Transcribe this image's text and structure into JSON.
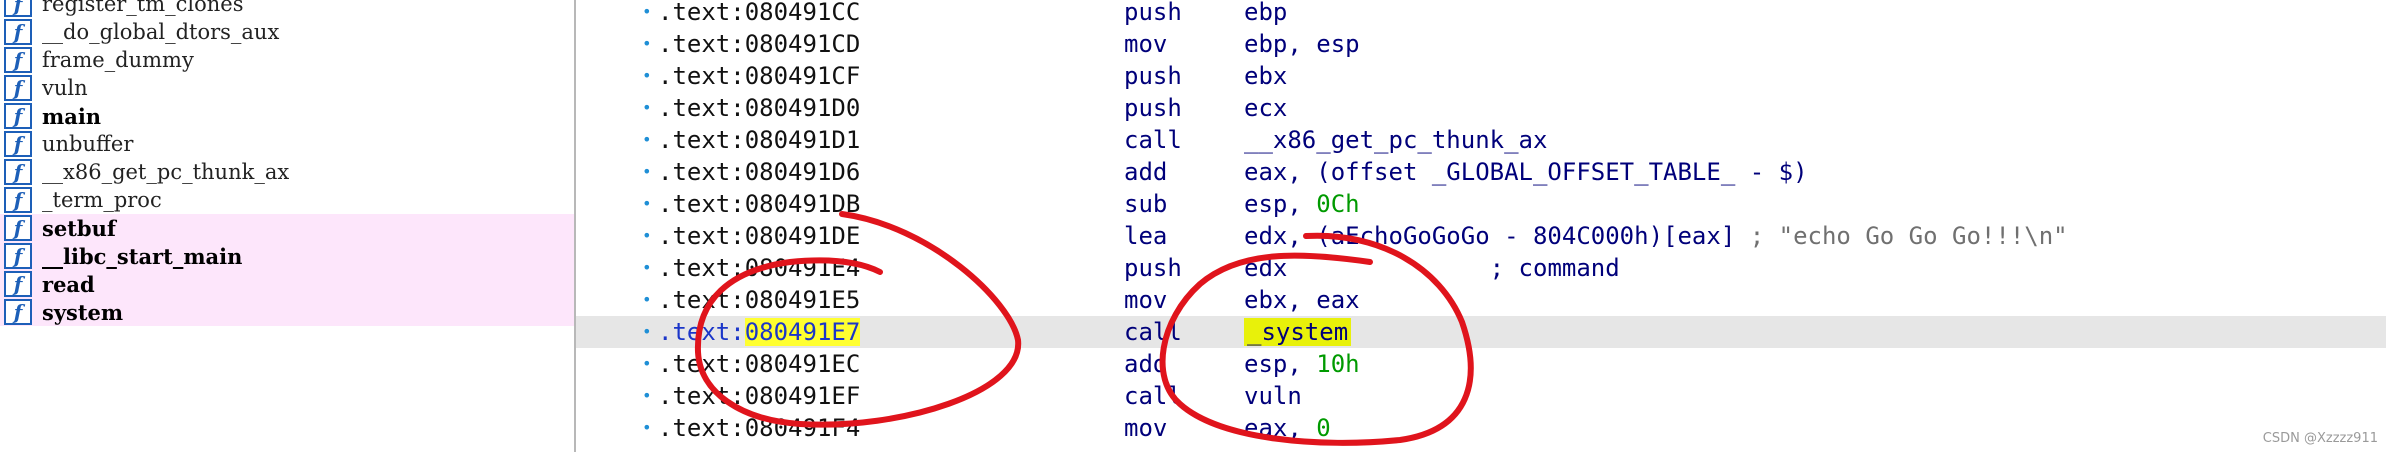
{
  "functions": [
    {
      "name": "register_tm_clones",
      "bold": false,
      "imported": false
    },
    {
      "name": "__do_global_dtors_aux",
      "bold": false,
      "imported": false
    },
    {
      "name": "frame_dummy",
      "bold": false,
      "imported": false
    },
    {
      "name": "vuln",
      "bold": false,
      "imported": false
    },
    {
      "name": "main",
      "bold": true,
      "imported": false
    },
    {
      "name": "unbuffer",
      "bold": false,
      "imported": false
    },
    {
      "name": "__x86_get_pc_thunk_ax",
      "bold": false,
      "imported": false
    },
    {
      "name": "_term_proc",
      "bold": false,
      "imported": false
    },
    {
      "name": "setbuf",
      "bold": true,
      "imported": true
    },
    {
      "name": "__libc_start_main",
      "bold": true,
      "imported": true
    },
    {
      "name": "read",
      "bold": true,
      "imported": true
    },
    {
      "name": "system",
      "bold": true,
      "imported": true
    }
  ],
  "function_icon": "function-icon",
  "disassembly": [
    {
      "seg": ".text:",
      "addr": "080491CC",
      "mnem": "push",
      "ops": [
        {
          "t": "ebp"
        }
      ]
    },
    {
      "seg": ".text:",
      "addr": "080491CD",
      "mnem": "mov",
      "ops": [
        {
          "t": "ebp, esp"
        }
      ]
    },
    {
      "seg": ".text:",
      "addr": "080491CF",
      "mnem": "push",
      "ops": [
        {
          "t": "ebx"
        }
      ]
    },
    {
      "seg": ".text:",
      "addr": "080491D0",
      "mnem": "push",
      "ops": [
        {
          "t": "ecx"
        }
      ]
    },
    {
      "seg": ".text:",
      "addr": "080491D1",
      "mnem": "call",
      "ops": [
        {
          "t": "__x86_get_pc_thunk_ax"
        }
      ]
    },
    {
      "seg": ".text:",
      "addr": "080491D6",
      "mnem": "add",
      "ops": [
        {
          "t": "eax, (offset _GLOBAL_OFFSET_TABLE_ - $)"
        }
      ]
    },
    {
      "seg": ".text:",
      "addr": "080491DB",
      "mnem": "sub",
      "ops": [
        {
          "t": "esp, "
        },
        {
          "t": "0Ch",
          "k": "num"
        }
      ]
    },
    {
      "seg": ".text:",
      "addr": "080491DE",
      "mnem": "lea",
      "ops": [
        {
          "t": "edx, (aEchoGoGoGo - 804C000h)[eax]"
        },
        {
          "t": " ; \"echo Go Go Go!!!\\n\"",
          "k": "comment"
        }
      ]
    },
    {
      "seg": ".text:",
      "addr": "080491E4",
      "mnem": "push",
      "ops": [
        {
          "t": "edx"
        },
        {
          "t": "              ; command",
          "k": "comment-blue"
        }
      ]
    },
    {
      "seg": ".text:",
      "addr": "080491E5",
      "mnem": "mov",
      "ops": [
        {
          "t": "ebx, eax"
        }
      ]
    },
    {
      "seg": ".text:",
      "addr": "080491E7",
      "mnem": "call",
      "ops": [
        {
          "t": "_system",
          "k": "sym"
        }
      ],
      "current": true
    },
    {
      "seg": ".text:",
      "addr": "080491EC",
      "mnem": "add",
      "ops": [
        {
          "t": "esp, "
        },
        {
          "t": "10h",
          "k": "num"
        }
      ]
    },
    {
      "seg": ".text:",
      "addr": "080491EF",
      "mnem": "call",
      "ops": [
        {
          "t": "vuln"
        }
      ]
    },
    {
      "seg": ".text:",
      "addr": "080491F4",
      "mnem": "mov",
      "ops": [
        {
          "t": "eax, "
        },
        {
          "t": "0",
          "k": "num"
        }
      ]
    }
  ],
  "annotation_color": "#e0141c",
  "watermark": "CSDN @Xzzzz911"
}
